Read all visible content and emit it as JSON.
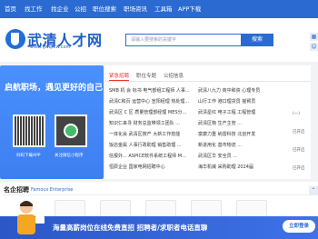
{
  "nav": {
    "items": [
      "首页",
      "找工作",
      "找企业",
      "公招",
      "职位搜索",
      "职场资讯",
      "工具箱",
      "APP下载"
    ]
  },
  "header": {
    "logo_text": "武清人才网",
    "logo_url": "www.fjwqrcw.com",
    "search_placeholder": "请输入要搜索的关键字",
    "search_button": "搜索"
  },
  "banner": {
    "title": "启航职场，遇见更好的自己",
    "qr1_caption": "扫码下载APP",
    "qr2_caption": "关注微信小程序"
  },
  "tabs": [
    "紧急招聘",
    "职位专题",
    "公招信息"
  ],
  "job_rows": [
    [
      "SMB 机 会",
      "标书",
      "电气部组工程师",
      "人事..."
    ],
    [
      "武清C和页",
      "运营中心",
      "宣阳经理",
      "热处理..."
    ],
    [
      "武清区 C 区",
      "质量管理部经理",
      "MES分..."
    ],
    [
      "知识仁来寻",
      "财务总监带领工团队",
      "..."
    ],
    [
      "一体化会",
      "武清区搜产",
      "大新工作技能"
    ],
    [
      "饭店金属",
      "人事行政助理",
      "销售助理",
      "..."
    ],
    [
      "信报外...",
      "ASPICE软件系统工程师",
      "M..."
    ],
    [
      "恒辰企业",
      "国家电网招聘中心"
    ]
  ],
  "job_rows_right": [
    [
      "武清八九力",
      "商中和资",
      "心理专员"
    ],
    [
      "山行工作",
      "港口理货员",
      "摇臂员"
    ],
    [
      "武清星红",
      "电子工程",
      "工程管理"
    ],
    [
      "武清区物",
      "生产主管",
      "..."
    ],
    [
      "富康力重",
      "纳雷科技",
      "北创开发"
    ],
    [
      "新进用化",
      "基市物流",
      "..."
    ],
    [
      "武清区华",
      "安全员",
      "..."
    ],
    [
      "海华机械",
      "采购助理",
      "2024届"
    ]
  ],
  "right_panel": [
    "(一)",
    "已开启",
    "已开启",
    "已开启"
  ],
  "famous": {
    "title": "名企招聘",
    "subtitle": "Famous Enterprise"
  },
  "promo": {
    "text": "海量高薪岗位在线免费直招 招聘者/求职者电话直聊",
    "button": "立即登录"
  },
  "colors": {
    "brand": "#2b6bd1",
    "accent": "#e53935",
    "promo": "#3e72e8"
  }
}
